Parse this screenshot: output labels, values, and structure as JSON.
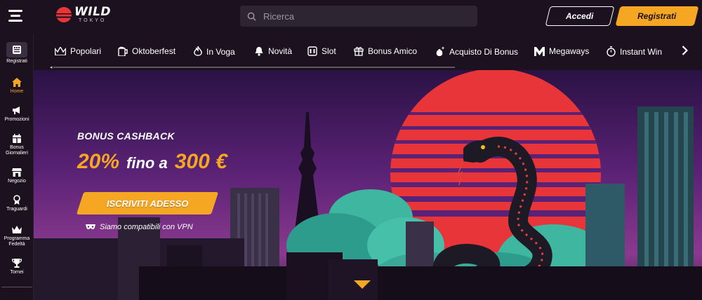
{
  "header": {
    "logo": {
      "name": "WILD",
      "sub": "TOKYO"
    },
    "search_placeholder": "Ricerca",
    "login_label": "Accedi",
    "register_label": "Registrati"
  },
  "sidebar": {
    "items": [
      {
        "label": "Registrati",
        "icon": "register-icon",
        "active": false
      },
      {
        "label": "Home",
        "icon": "home-icon",
        "active": true
      },
      {
        "label": "Promozioni",
        "icon": "megaphone-icon",
        "active": false
      },
      {
        "label": "Bonus Giornalieri",
        "icon": "calendar-gift-icon",
        "active": false
      },
      {
        "label": "Negozio",
        "icon": "shop-icon",
        "active": false
      },
      {
        "label": "Traguardi",
        "icon": "medal-icon",
        "active": false
      },
      {
        "label": "Programma Fedeltà",
        "icon": "crown-icon",
        "active": false
      },
      {
        "label": "Tornei",
        "icon": "trophy-icon",
        "active": false
      }
    ]
  },
  "categories": [
    {
      "label": "Popolari",
      "icon": "crown-icon"
    },
    {
      "label": "Oktoberfest",
      "icon": "beer-mug-icon"
    },
    {
      "label": "In Voga",
      "icon": "flame-icon"
    },
    {
      "label": "Novità",
      "icon": "bell-icon"
    },
    {
      "label": "Slot",
      "icon": "slot-icon"
    },
    {
      "label": "Bonus Amico",
      "icon": "gift-icon"
    },
    {
      "label": "Acquisto Di Bonus",
      "icon": "sparkle-bag-icon"
    },
    {
      "label": "Megaways",
      "icon": "megaways-icon"
    },
    {
      "label": "Instant Win",
      "icon": "stopwatch-icon"
    }
  ],
  "hero": {
    "label": "BONUS CASHBACK",
    "pct": "20%",
    "mid": "fino a",
    "amount": "300 €",
    "cta": "ISCRIVITI ADESSO",
    "vpn_note": "Siamo compatibili con VPN"
  },
  "colors": {
    "accent": "#f5a623",
    "bg": "#1c121f",
    "sun": "#e8353a"
  }
}
